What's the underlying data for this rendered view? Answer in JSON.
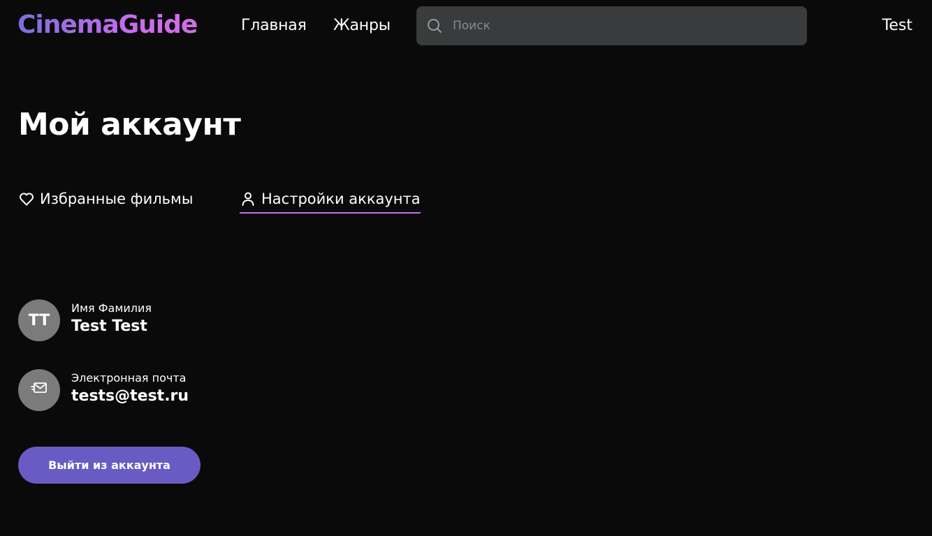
{
  "header": {
    "logo": "CinemaGuide",
    "nav": [
      {
        "label": "Главная"
      },
      {
        "label": "Жанры"
      }
    ],
    "search": {
      "placeholder": "Поиск",
      "value": "",
      "icon": "search-icon"
    },
    "user_label": "Test"
  },
  "page": {
    "title": "Мой аккаунт"
  },
  "tabs": [
    {
      "label": "Избранные фильмы",
      "icon": "heart-icon",
      "active": false
    },
    {
      "label": "Настройки аккаунта",
      "icon": "user-icon",
      "active": true
    }
  ],
  "account": {
    "name_label": "Имя Фамилия",
    "name_value": "Test Test",
    "avatar_initials": "TT",
    "email_label": "Электронная почта",
    "email_value": "tests@test.ru",
    "email_icon": "mail-icon"
  },
  "logout_label": "Выйти из аккаунта",
  "colors": {
    "background": "#0a0a0a",
    "accent": "#c66cf0",
    "button": "#6a5bc4",
    "search_bg": "#393b3c",
    "avatar_bg": "#7b7b7b"
  }
}
